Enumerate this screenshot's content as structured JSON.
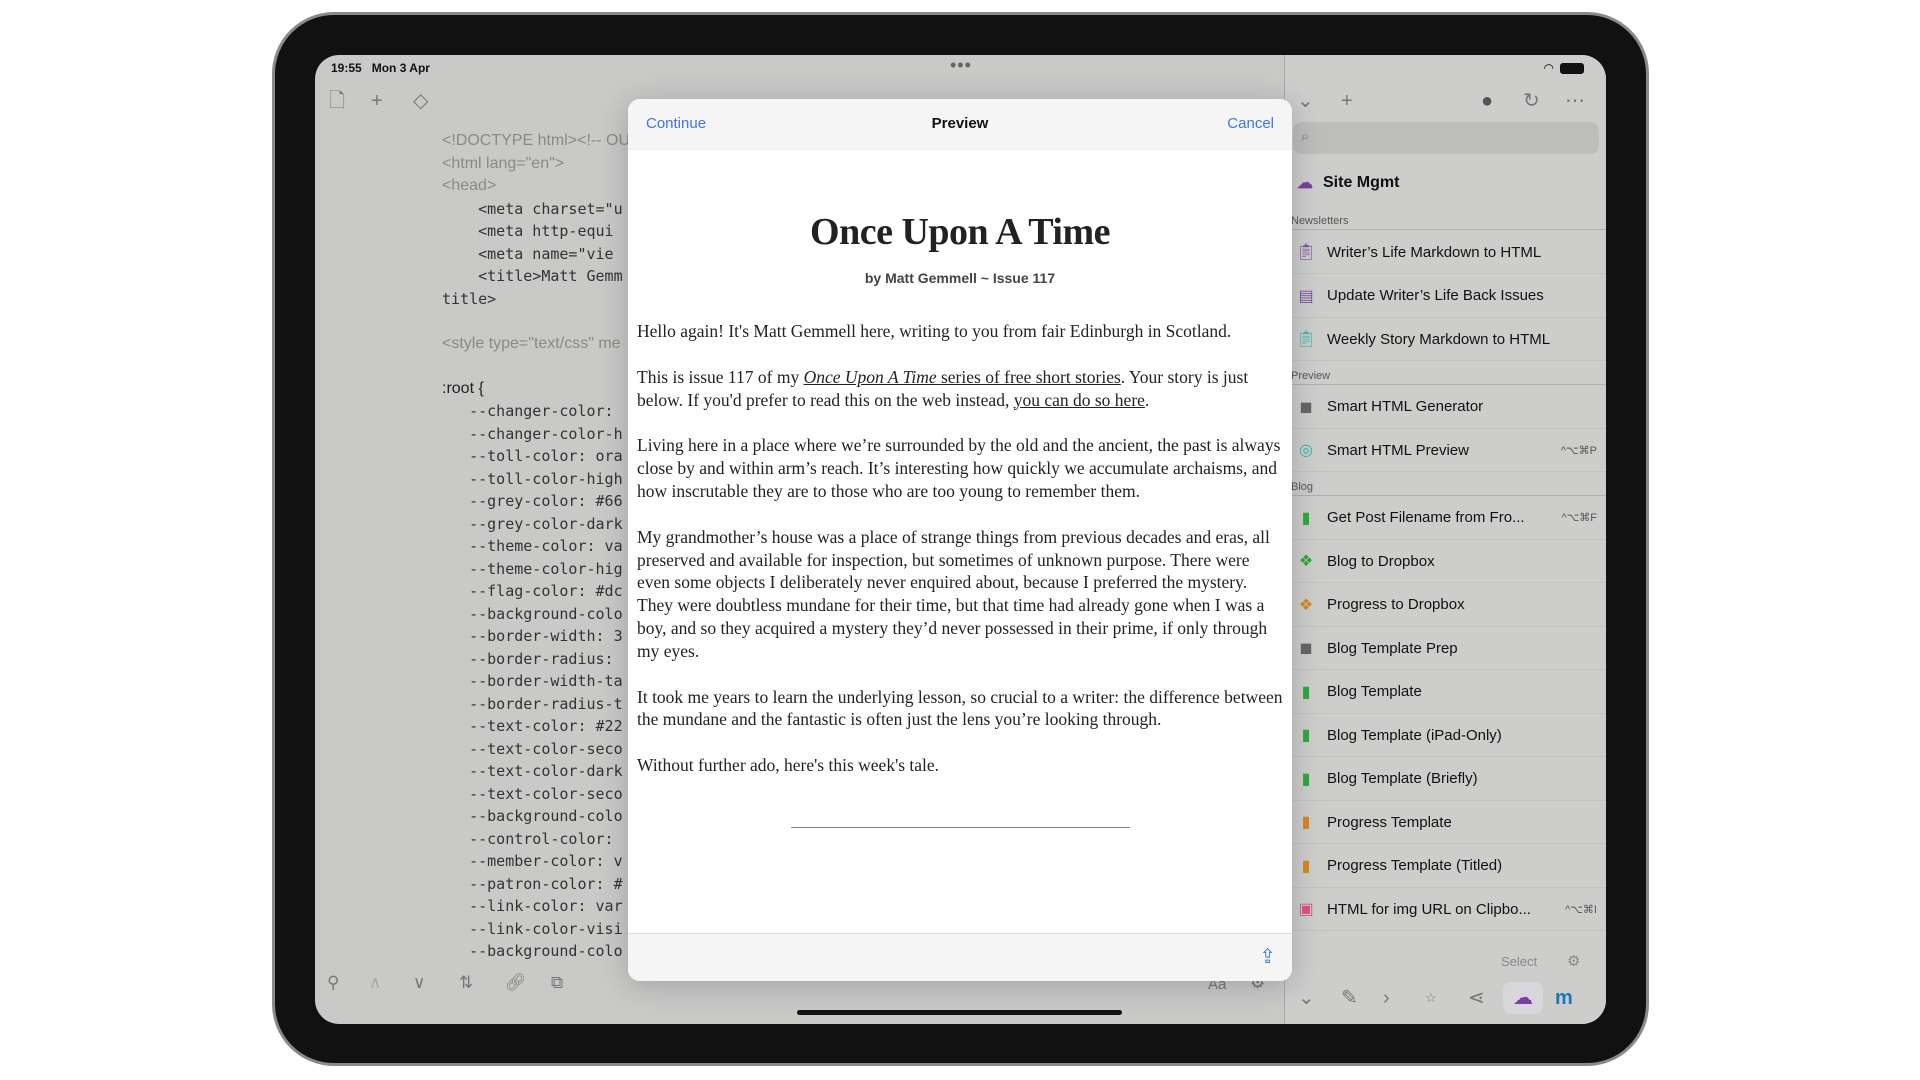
{
  "status": {
    "time": "19:55",
    "date": "Mon 3 Apr",
    "multitask": "•••"
  },
  "editor": {
    "code_lines": [
      {
        "t": "<!DOCTYPE html><!-- OU",
        "k": "prop"
      },
      {
        "t": "<html lang=\"en\">",
        "k": "prop"
      },
      {
        "t": "<head>",
        "k": "prop"
      },
      {
        "t": "    <meta charset=\"u",
        "k": "mono"
      },
      {
        "t": "    <meta http-equi",
        "k": "mono"
      },
      {
        "t": "    <meta name=\"vie",
        "k": "mono"
      },
      {
        "t": "    <title>Matt Gemm",
        "k": "mono"
      },
      {
        "t": "title>",
        "k": "mono"
      },
      {
        "t": " ",
        "k": "prop"
      },
      {
        "t": "<style type=\"text/css\" me",
        "k": "prop"
      },
      {
        "t": " ",
        "k": "prop"
      },
      {
        "t": ":root {",
        "k": "prop dark"
      },
      {
        "t": "   --changer-color:",
        "k": "mono"
      },
      {
        "t": "   --changer-color-h",
        "k": "mono"
      },
      {
        "t": "   --toll-color: ora",
        "k": "mono"
      },
      {
        "t": "   --toll-color-high",
        "k": "mono"
      },
      {
        "t": "   --grey-color: #66",
        "k": "mono"
      },
      {
        "t": "   --grey-color-dark",
        "k": "mono"
      },
      {
        "t": "   --theme-color: va",
        "k": "mono"
      },
      {
        "t": "   --theme-color-hig",
        "k": "mono"
      },
      {
        "t": "   --flag-color: #dc",
        "k": "mono"
      },
      {
        "t": "   --background-colo",
        "k": "mono"
      },
      {
        "t": "   --border-width: 3",
        "k": "mono"
      },
      {
        "t": "   --border-radius:",
        "k": "mono"
      },
      {
        "t": "   --border-width-ta",
        "k": "mono"
      },
      {
        "t": "   --border-radius-t",
        "k": "mono"
      },
      {
        "t": "   --text-color: #22",
        "k": "mono"
      },
      {
        "t": "   --text-color-seco",
        "k": "mono"
      },
      {
        "t": "   --text-color-dark",
        "k": "mono"
      },
      {
        "t": "   --text-color-seco",
        "k": "mono"
      },
      {
        "t": "   --background-colo",
        "k": "mono"
      },
      {
        "t": "   --control-color:",
        "k": "mono"
      },
      {
        "t": "   --member-color: v",
        "k": "mono"
      },
      {
        "t": "   --patron-color: #",
        "k": "mono"
      },
      {
        "t": "   --link-color: var",
        "k": "mono"
      },
      {
        "t": "   --link-color-visi",
        "k": "mono"
      },
      {
        "t": "   --background-colo",
        "k": "mono"
      }
    ],
    "bottom_right": {
      "font_label": "Aa"
    }
  },
  "modal": {
    "continue": "Continue",
    "title": "Preview",
    "cancel": "Cancel",
    "doc_title": "Once Upon A Time",
    "byline": "by Matt Gemmell  ~  Issue 117",
    "p1": "Hello again! It's Matt Gemmell here, writing to you from fair Edinburgh in Scotland.",
    "p2a": "This is issue 117 of my ",
    "p2_link_italic": "Once Upon A Time",
    "p2_link_rest": " series of free short stories",
    "p2b": ". Your story is just below. If you'd prefer to read this on the web instead, ",
    "p2_link2": "you can do so here",
    "p2c": ".",
    "p3": "Living here in a place where we’re surrounded by the old and the ancient, the past is always close by and within arm’s reach. It’s interesting how quickly we accumulate archaisms, and how inscrutable they are to those who are too young to remember them.",
    "p4": "My grandmother’s house was a place of strange things from previous decades and eras, all preserved and available for inspection, but sometimes of unknown purpose. There were even some objects I deliberately never enquired about, because I preferred the mystery. They were doubtless mundane for their time, but that time had already gone when I was a boy, and so they acquired a mystery they’d never possessed in their prime, if only through my eyes.",
    "p5": "It took me years to learn the underlying lesson, so crucial to a writer: the difference between the mundane and the fantastic is often just the lens you’re looking through.",
    "p6": "Without further ado, here's this week's tale."
  },
  "sidebar": {
    "title": "Site Mgmt",
    "sections": [
      {
        "name": "Newsletters",
        "items": [
          {
            "label": "Writer’s Life Markdown to HTML",
            "icon": "clipboard-icon",
            "color": "#7a4fa0",
            "shortcut": ""
          },
          {
            "label": "Update Writer’s Life Back Issues",
            "icon": "newspaper-icon",
            "color": "#7a4fa0",
            "shortcut": ""
          },
          {
            "label": "Weekly Story Markdown to HTML",
            "icon": "clipboard-icon",
            "color": "#2fb5b0",
            "shortcut": ""
          }
        ]
      },
      {
        "name": "Preview",
        "items": [
          {
            "label": "Smart HTML Generator",
            "icon": "package-icon",
            "color": "#666666",
            "shortcut": ""
          },
          {
            "label": "Smart HTML Preview",
            "icon": "compass-icon",
            "color": "#2fb5b0",
            "shortcut": "^⌥⌘P"
          }
        ]
      },
      {
        "name": "Blog",
        "items": [
          {
            "label": "Get Post Filename from Fro...",
            "icon": "document-icon",
            "color": "#2ea83a",
            "shortcut": "^⌥⌘F"
          },
          {
            "label": "Blog to Dropbox",
            "icon": "dropbox-icon",
            "color": "#2ea83a",
            "shortcut": ""
          },
          {
            "label": "Progress to Dropbox",
            "icon": "dropbox-icon",
            "color": "#d08a1e",
            "shortcut": ""
          },
          {
            "label": "Blog Template Prep",
            "icon": "package-icon",
            "color": "#666666",
            "shortcut": ""
          },
          {
            "label": "Blog Template",
            "icon": "document-plus-icon",
            "color": "#2ea83a",
            "shortcut": ""
          },
          {
            "label": "Blog Template (iPad-Only)",
            "icon": "document-plus-icon",
            "color": "#2ea83a",
            "shortcut": ""
          },
          {
            "label": "Blog Template (Briefly)",
            "icon": "document-plus-icon",
            "color": "#2ea83a",
            "shortcut": ""
          },
          {
            "label": "Progress Template",
            "icon": "document-plus-icon",
            "color": "#d08a1e",
            "shortcut": ""
          },
          {
            "label": "Progress Template (Titled)",
            "icon": "document-plus-icon",
            "color": "#d08a1e",
            "shortcut": ""
          },
          {
            "label": "HTML for img URL on Clipbo...",
            "icon": "image-icon",
            "color": "#e0508a",
            "shortcut": "^⌥⌘I"
          }
        ]
      }
    ],
    "select": "Select",
    "accent": "#7a3fa0"
  }
}
